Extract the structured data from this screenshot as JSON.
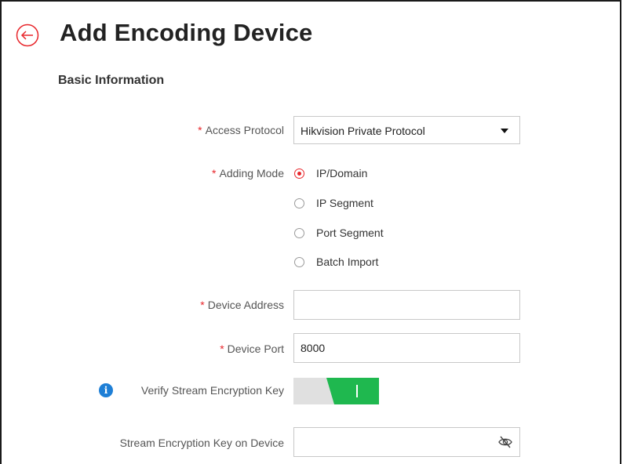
{
  "header": {
    "title": "Add Encoding Device"
  },
  "section": {
    "title": "Basic Information"
  },
  "form": {
    "required_mark": "*",
    "access_protocol": {
      "label": "Access Protocol",
      "value": "Hikvision Private Protocol"
    },
    "adding_mode": {
      "label": "Adding Mode",
      "options": [
        {
          "label": "IP/Domain",
          "checked": true
        },
        {
          "label": "IP Segment",
          "checked": false
        },
        {
          "label": "Port Segment",
          "checked": false
        },
        {
          "label": "Batch Import",
          "checked": false
        }
      ]
    },
    "device_address": {
      "label": "Device Address",
      "value": "",
      "placeholder": ""
    },
    "device_port": {
      "label": "Device Port",
      "value": "8000"
    },
    "verify_key": {
      "label": "Verify Stream Encryption Key",
      "enabled": true
    },
    "stream_key": {
      "label": "Stream Encryption Key on Device",
      "value": ""
    }
  },
  "icons": {
    "back": "back-arrow-icon",
    "dropdown": "caret-down-icon",
    "info": "info-icon",
    "visibility": "eye-hidden-icon"
  },
  "colors": {
    "accent_red": "#e8262b",
    "toggle_on": "#1fb84f",
    "toggle_off": "#e0e0e0",
    "info_blue": "#1e7fd6"
  }
}
